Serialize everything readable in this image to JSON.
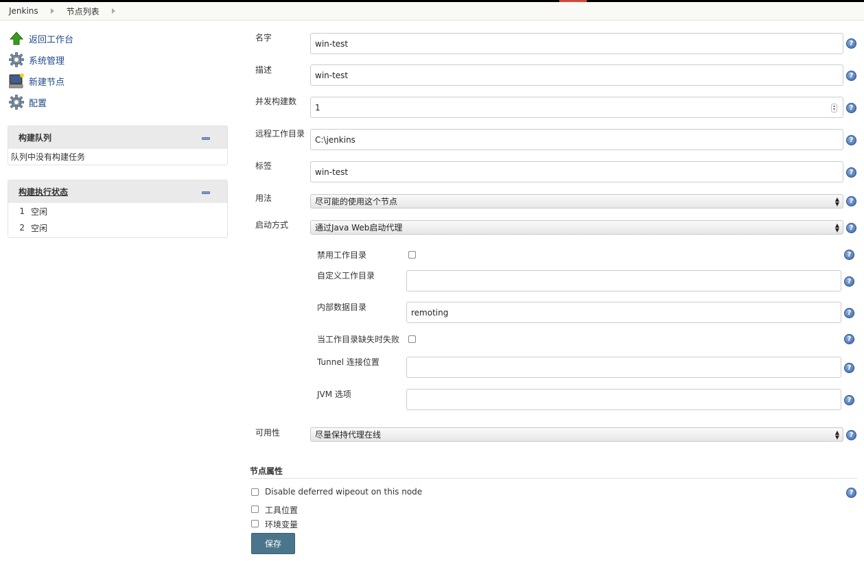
{
  "breadcrumb": {
    "items": [
      "Jenkins",
      "节点列表"
    ]
  },
  "sidebar": {
    "tasks": [
      {
        "label": "返回工作台",
        "icon": "up-arrow-icon"
      },
      {
        "label": "系统管理",
        "icon": "gear-icon"
      },
      {
        "label": "新建节点",
        "icon": "computer-icon"
      },
      {
        "label": "配置",
        "icon": "gear-icon"
      }
    ],
    "queue": {
      "title": "构建队列",
      "empty_text": "队列中没有构建任务"
    },
    "executors": {
      "title": "构建执行状态",
      "rows": [
        {
          "num": "1",
          "status": "空闲"
        },
        {
          "num": "2",
          "status": "空闲"
        }
      ]
    }
  },
  "form": {
    "name": {
      "label": "名字",
      "value": "win-test"
    },
    "description": {
      "label": "描述",
      "value": "win-test"
    },
    "executors": {
      "label": "并发构建数",
      "value": "1"
    },
    "remote_dir": {
      "label": "远程工作目录",
      "value": "C:\\jenkins"
    },
    "labels": {
      "label": "标签",
      "value": "win-test"
    },
    "usage": {
      "label": "用法",
      "value": "尽可能的使用这个节点"
    },
    "launch": {
      "label": "启动方式",
      "value": "通过Java Web启动代理"
    },
    "disable_workdir": {
      "label": "禁用工作目录"
    },
    "custom_workdir": {
      "label": "自定义工作目录",
      "value": ""
    },
    "internal_dir": {
      "label": "内部数据目录",
      "value": "remoting"
    },
    "fail_missing": {
      "label": "当工作目录缺失时失败"
    },
    "tunnel": {
      "label": "Tunnel 连接位置",
      "value": ""
    },
    "jvm": {
      "label": "JVM 选项",
      "value": ""
    },
    "availability": {
      "label": "可用性",
      "value": "尽量保持代理在线"
    },
    "node_props": {
      "title": "节点属性",
      "options": [
        "Disable deferred wipeout on this node",
        "工具位置",
        "环境变量"
      ]
    },
    "save_label": "保存",
    "help_glyph": "?"
  },
  "colors": {
    "link": "#204a87",
    "save_button": "#4b758b",
    "help": "#3a66a8"
  }
}
